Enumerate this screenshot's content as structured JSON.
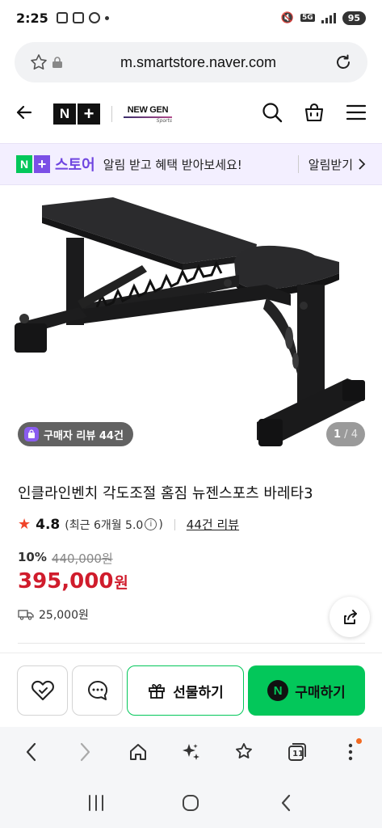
{
  "status_bar": {
    "time": "2:25",
    "battery": "95",
    "network": "5G"
  },
  "browser": {
    "url": "m.smartstore.naver.com"
  },
  "header": {
    "logo_n": "N",
    "logo_plus": "+",
    "brand_name": "NEW GEN",
    "brand_sub": "Sports"
  },
  "banner": {
    "badge_n": "N",
    "badge_plus": "+",
    "store_label": "스토어",
    "text": "알림 받고 혜택 받아보세요!",
    "cta": "알림받기"
  },
  "gallery": {
    "review_pill": "구매자 리뷰 44건",
    "current": "1",
    "total": "4"
  },
  "product": {
    "title": "인클라인벤치 각도조절 홈짐 뉴젠스포츠 바레타3",
    "rating": "4.8",
    "rating_note": "(최근 6개월 5.0",
    "rating_note_end": ")",
    "review_link": "44건 리뷰",
    "discount_rate": "10%",
    "original_price": "440,000원",
    "price": "395,000",
    "price_unit": "원",
    "shipping": "25,000원"
  },
  "actions": {
    "gift_label": "선물하기",
    "buy_label": "구매하기",
    "buy_badge": "N"
  },
  "browser_nav": {
    "tabs_count": "11"
  },
  "colors": {
    "naver_green": "#03c75a",
    "price_red": "#d01c2c",
    "store_purple": "#6f45e0",
    "star_red": "#f0442a"
  }
}
